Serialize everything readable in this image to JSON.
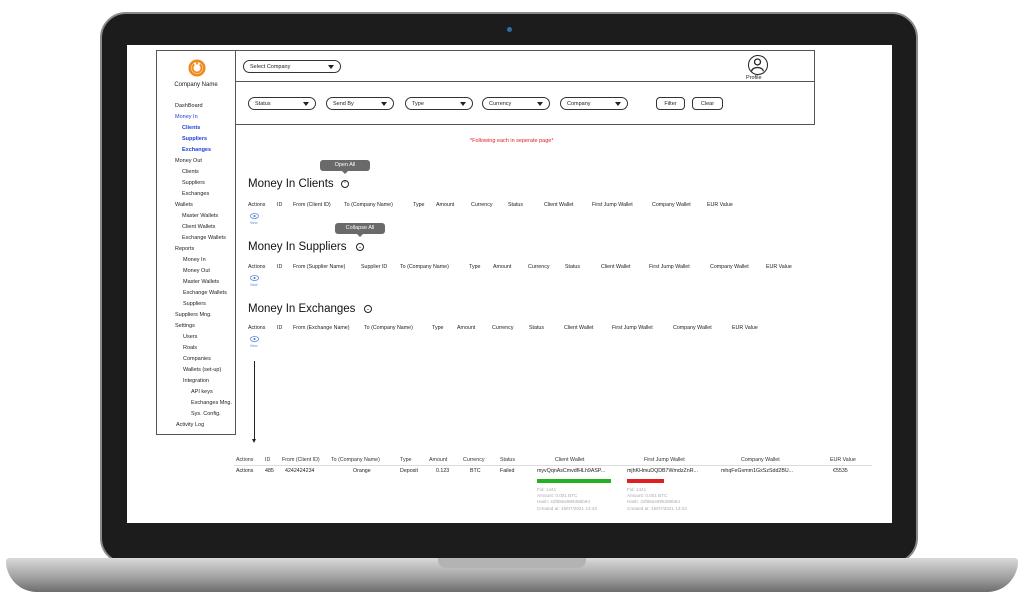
{
  "app": {
    "company_name": "Company Name",
    "profile_label": "Profile",
    "notice": "*Following each in seperate page*",
    "brand_color": "#f28a1a",
    "accent_color": "#1f3fd6"
  },
  "sidebar": {
    "items": [
      {
        "label": "DashBoard"
      },
      {
        "label": "Money In"
      },
      {
        "label": "Clients"
      },
      {
        "label": "Suppliers"
      },
      {
        "label": "Exchanges"
      },
      {
        "label": "Money Out"
      },
      {
        "label": "Clients"
      },
      {
        "label": "Suppliers"
      },
      {
        "label": "Exchanges"
      },
      {
        "label": "Wallets"
      },
      {
        "label": "Master Wallets"
      },
      {
        "label": "Client Wallets"
      },
      {
        "label": "Exchange Wallets"
      },
      {
        "label": "Reports"
      },
      {
        "label": "Money In"
      },
      {
        "label": "Money Out"
      },
      {
        "label": "Master Wallets"
      },
      {
        "label": "Exchange Wallets"
      },
      {
        "label": "Suppliers"
      },
      {
        "label": "Suppliers Mng."
      },
      {
        "label": "Settings"
      },
      {
        "label": "Users"
      },
      {
        "label": "Roals"
      },
      {
        "label": "Companies"
      },
      {
        "label": "Wallets (set-up)"
      },
      {
        "label": "Integration"
      },
      {
        "label": "API keys"
      },
      {
        "label": "Exchanges Mng."
      },
      {
        "label": "Sys. Config."
      },
      {
        "label": "Activity Log"
      }
    ]
  },
  "topbar": {
    "company_select": "Select Company"
  },
  "filters": {
    "status": "Status",
    "send_by": "Send By",
    "type": "Type",
    "currency": "Currency",
    "company": "Company",
    "filter_button": "Filter",
    "clear_button": "Clear"
  },
  "tooltips": {
    "open_all": "Open All",
    "collapse_all": "Collapse All"
  },
  "sections": {
    "clients": {
      "title": "Money In Clients",
      "columns": [
        "Actions",
        "ID",
        "From (Client ID)",
        "To (Company Name)",
        "Type",
        "Amount",
        "Currency",
        "Status",
        "Client Wallet",
        "First Jump Wallet",
        "Company Wallet",
        "EUR Value"
      ]
    },
    "suppliers": {
      "title": "Money In Suppliers",
      "columns": [
        "Actions",
        "ID",
        "From (Supplier Name)",
        "Supplier ID",
        "To (Company Name)",
        "Type",
        "Amount",
        "Currency",
        "Status",
        "Client Wallet",
        "First Jump Wallet",
        "Company Wallet",
        "EUR Value"
      ]
    },
    "exchanges": {
      "title": "Money In Exchanges",
      "columns": [
        "Actions",
        "ID",
        "From (Exchange Name)",
        "To (Company Name)",
        "Type",
        "Amount",
        "Currency",
        "Status",
        "Client Wallet",
        "First Jump Wallet",
        "Company Wallet",
        "EUR Value"
      ]
    },
    "view_label": "View"
  },
  "detail_table": {
    "columns": [
      "Actions",
      "ID",
      "From (Client ID)",
      "To (Company Name)",
      "Type",
      "Amount",
      "Currency",
      "Status",
      "Client Wallet",
      "First Jump Wallet",
      "Company Wallet",
      "EUR Value"
    ],
    "row": [
      "Actions",
      "485",
      "4242424234",
      "Orange",
      "Deposit",
      "0.123",
      "BTC",
      "Failed",
      "myvQqnAsCmvdfHLh9ASP...",
      "mjhKHmuDQDB7WmdzZnR...",
      "mhqFeGvmm1GxSzSdd2BU...",
      "€5535"
    ],
    "client_wallet_bar_color": "#22b122",
    "first_jump_bar_color": "#e02020",
    "client_wallet_details": [
      "Fid: 1441",
      "Amount: 0.001 BTC",
      "Hash: 42f86ee995386b64",
      "Created at: 19/07/2021 13:43"
    ],
    "first_jump_details": [
      "Fid: 1441",
      "Amount: 0.001 BTC",
      "Hash: 42f86ee995386b64",
      "Created at: 19/07/2021 13:43"
    ]
  }
}
